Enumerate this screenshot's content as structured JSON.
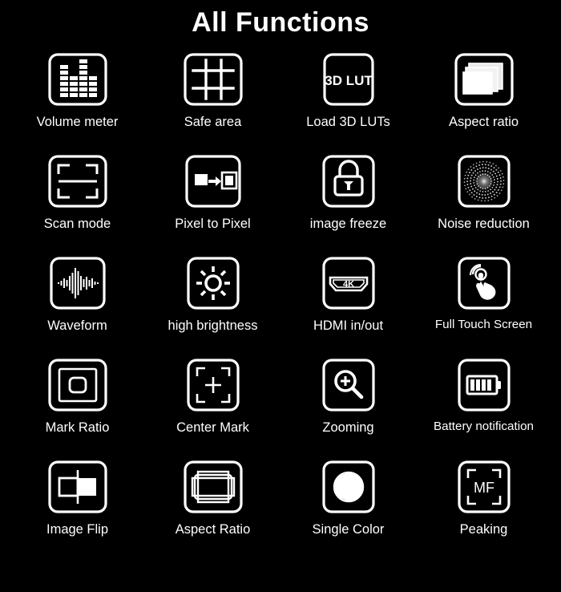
{
  "header": {
    "title": "All Functions"
  },
  "theme": {
    "background": "#000000",
    "foreground": "#ffffff"
  },
  "grid": {
    "columns": 4,
    "rows": 5
  },
  "functions": [
    {
      "icon": "volume-meter-icon",
      "label": "Volume meter"
    },
    {
      "icon": "safe-area-grid-icon",
      "label": "Safe area"
    },
    {
      "icon": "3d-lut-icon",
      "label": "Load 3D LUTs",
      "icon_text": "3D LUT"
    },
    {
      "icon": "aspect-ratio-stack-icon",
      "label": "Aspect ratio"
    },
    {
      "icon": "scan-mode-icon",
      "label": "Scan mode"
    },
    {
      "icon": "pixel-to-pixel-icon",
      "label": "Pixel to Pixel"
    },
    {
      "icon": "image-freeze-lock-icon",
      "label": "image freeze"
    },
    {
      "icon": "noise-reduction-icon",
      "label": "Noise reduction"
    },
    {
      "icon": "waveform-icon",
      "label": "Waveform"
    },
    {
      "icon": "high-brightness-sun-icon",
      "label": "high brightness"
    },
    {
      "icon": "hdmi-port-icon",
      "label": "HDMI in/out",
      "icon_text": "4K"
    },
    {
      "icon": "touch-screen-hand-icon",
      "label": "Full Touch Screen"
    },
    {
      "icon": "mark-ratio-icon",
      "label": "Mark Ratio"
    },
    {
      "icon": "center-mark-icon",
      "label": "Center Mark"
    },
    {
      "icon": "zoom-magnifier-icon",
      "label": "Zooming"
    },
    {
      "icon": "battery-icon",
      "label": "Battery notification"
    },
    {
      "icon": "image-flip-icon",
      "label": "Image Flip"
    },
    {
      "icon": "aspect-ratio-frames-icon",
      "label": "Aspect Ratio"
    },
    {
      "icon": "single-color-sphere-icon",
      "label": "Single Color"
    },
    {
      "icon": "peaking-mf-icon",
      "label": "Peaking",
      "icon_text": "MF"
    }
  ]
}
